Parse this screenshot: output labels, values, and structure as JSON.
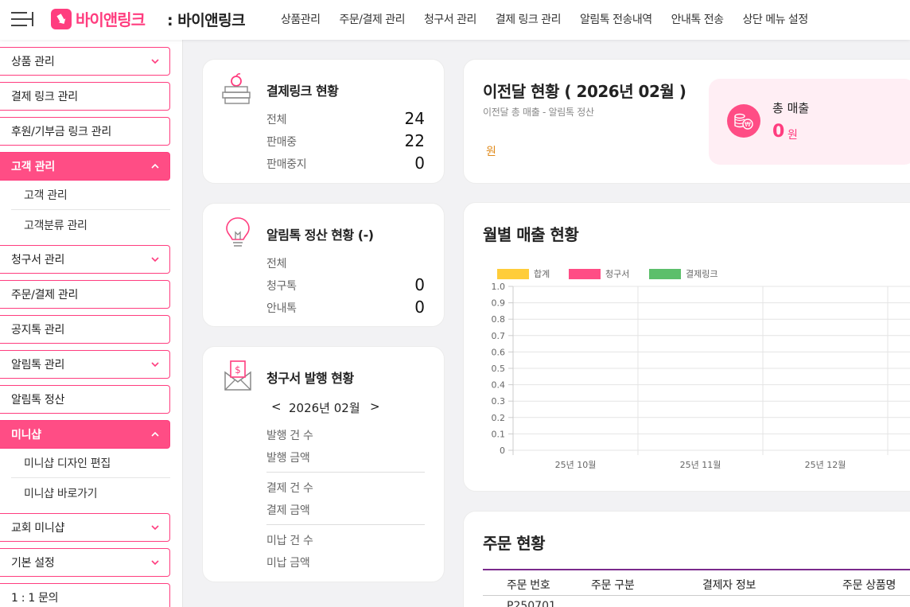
{
  "header": {
    "logo_text": "바이앤링크",
    "store_name": ": 바이앤링크",
    "nav": [
      "상품관리",
      "주문/결제 관리",
      "청구서 관리",
      "결제 링크 관리",
      "알림톡 전송내역",
      "안내톡 전송",
      "상단 메뉴 설정"
    ]
  },
  "sidebar": {
    "items": [
      {
        "label": "상품 관리"
      },
      {
        "label": "결제 링크 관리"
      },
      {
        "label": "후원/기부금 링크 관리"
      },
      {
        "label": "고객 관리"
      },
      {
        "label": "고객 관리"
      },
      {
        "label": "고객분류 관리"
      },
      {
        "label": "청구서 관리"
      },
      {
        "label": "주문/결제 관리"
      },
      {
        "label": "공지톡 관리"
      },
      {
        "label": "알림톡 관리"
      },
      {
        "label": "알림톡 정산"
      },
      {
        "label": "미니샵"
      },
      {
        "label": "미니샵 디자인 편집"
      },
      {
        "label": "미니샵 바로가기"
      },
      {
        "label": "교회 미니샵"
      },
      {
        "label": "기본 설정"
      },
      {
        "label": "1 : 1 문의"
      }
    ]
  },
  "link_status": {
    "title": "결제링크 현황",
    "rows": [
      {
        "label": "전체",
        "value": "24"
      },
      {
        "label": "판매중",
        "value": "22"
      },
      {
        "label": "판매중지",
        "value": "0"
      }
    ]
  },
  "alimtalk_status": {
    "title": "알림톡 정산 현황 (-)",
    "rows": [
      {
        "label": "전체",
        "value": ""
      },
      {
        "label": "청구톡",
        "value": "0"
      },
      {
        "label": "안내톡",
        "value": "0"
      }
    ]
  },
  "invoice_status": {
    "title": "청구서 발행 현황",
    "prev": "<",
    "month": "2026년 02월",
    "next": ">",
    "rows": [
      "발행 건 수",
      "발행 금액",
      "결제 건 수",
      "결제 금액",
      "미납 건 수",
      "미납 금액"
    ]
  },
  "prev_month": {
    "title": "이전달 현황 ( 2026년 02월 )",
    "desc": "이전달 총 매출 - 알림톡 정산",
    "amount_unit": "원",
    "sales_label": "총 매출",
    "sales_value": "0",
    "sales_unit": "원"
  },
  "monthly_sales": {
    "title": "월별 매출 현황"
  },
  "orders": {
    "title": "주문 현황",
    "columns": [
      "주문 번호",
      "주문 구분",
      "결제자 정보",
      "주문 상품명"
    ],
    "first_row_partial": "P250701"
  },
  "colors": {
    "accent": "#ff3d7f",
    "legend_total": "#ffcd3a",
    "legend_invoice": "#ff4d85",
    "legend_link": "#5cbf6b"
  },
  "chart_data": {
    "type": "bar",
    "categories": [
      "25년 10월",
      "25년 11월",
      "25년 12월"
    ],
    "series": [
      {
        "name": "합계",
        "values": [
          0,
          0,
          0
        ]
      },
      {
        "name": "청구서",
        "values": [
          0,
          0,
          0
        ]
      },
      {
        "name": "결제링크",
        "values": [
          0,
          0,
          0
        ]
      }
    ],
    "yticks": [
      "1.0",
      "0.9",
      "0.8",
      "0.7",
      "0.6",
      "0.5",
      "0.4",
      "0.3",
      "0.2",
      "0.1",
      "0"
    ],
    "ylim": [
      0,
      1.0
    ],
    "grid": true,
    "legend": "top-left"
  }
}
